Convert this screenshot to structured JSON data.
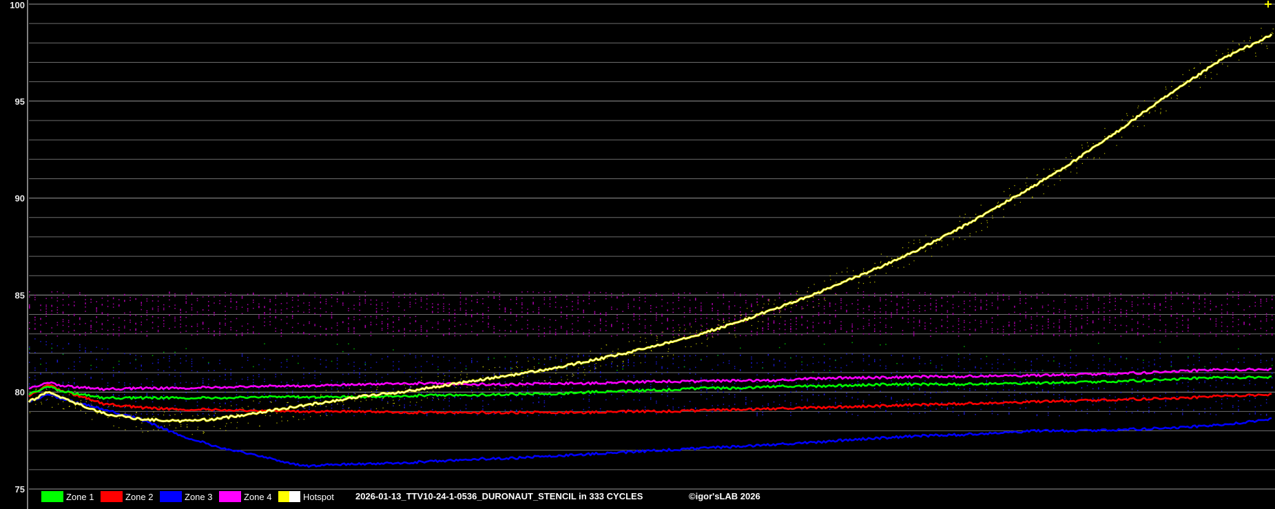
{
  "chart_data": {
    "type": "line",
    "title": "",
    "caption": "2026-01-13_TTV10-24-1-0536_DURONAUT_STENCIL in 333 CYCLES",
    "copyright": "©igor'sLAB 2026",
    "xlabel": "",
    "ylabel": "",
    "ylim": [
      75,
      100
    ],
    "xlim": [
      0,
      333
    ],
    "y_ticks": [
      "100",
      "95",
      "90",
      "85",
      "80",
      "75"
    ],
    "y_tick_values": [
      100,
      95,
      90,
      85,
      80,
      75
    ],
    "grid": true,
    "legend_position": "bottom-left",
    "background": "#000000",
    "series": [
      {
        "name": "Zone 1",
        "color": "#00ff00",
        "x": [
          0,
          5,
          10,
          20,
          30,
          40,
          50,
          60,
          70,
          80,
          90,
          100,
          110,
          120,
          130,
          140,
          150,
          160,
          170,
          180,
          190,
          200,
          210,
          220,
          230,
          240,
          250,
          260,
          270,
          280,
          290,
          300,
          310,
          320,
          333
        ],
        "y": [
          79.9,
          80.3,
          80.0,
          79.7,
          79.7,
          79.7,
          79.7,
          79.75,
          79.75,
          79.75,
          79.75,
          79.8,
          79.85,
          79.85,
          79.9,
          79.9,
          80.0,
          80.05,
          80.1,
          80.2,
          80.2,
          80.3,
          80.3,
          80.35,
          80.4,
          80.4,
          80.4,
          80.45,
          80.45,
          80.5,
          80.55,
          80.6,
          80.7,
          80.75,
          80.75
        ]
      },
      {
        "name": "Zone 2",
        "color": "#ff0000",
        "x": [
          0,
          5,
          10,
          20,
          30,
          40,
          50,
          60,
          70,
          80,
          90,
          100,
          110,
          120,
          130,
          140,
          150,
          160,
          170,
          180,
          190,
          200,
          210,
          220,
          230,
          240,
          250,
          260,
          270,
          280,
          290,
          300,
          310,
          320,
          333
        ],
        "y": [
          79.8,
          80.4,
          80.0,
          79.4,
          79.2,
          79.1,
          79.1,
          79.05,
          79.0,
          79.0,
          79.0,
          78.95,
          78.95,
          78.95,
          78.95,
          78.95,
          78.95,
          79.0,
          79.0,
          79.05,
          79.1,
          79.15,
          79.2,
          79.25,
          79.3,
          79.35,
          79.4,
          79.45,
          79.5,
          79.55,
          79.6,
          79.65,
          79.7,
          79.8,
          79.85
        ]
      },
      {
        "name": "Zone 3",
        "color": "#0000ff",
        "x": [
          0,
          5,
          10,
          20,
          30,
          40,
          50,
          60,
          70,
          75,
          80,
          90,
          100,
          110,
          120,
          130,
          140,
          150,
          160,
          170,
          180,
          190,
          200,
          210,
          220,
          230,
          240,
          250,
          260,
          270,
          280,
          290,
          300,
          310,
          320,
          333
        ],
        "y": [
          79.5,
          79.9,
          79.6,
          79.1,
          78.6,
          77.8,
          77.2,
          76.8,
          76.3,
          76.2,
          76.25,
          76.3,
          76.35,
          76.45,
          76.55,
          76.6,
          76.7,
          76.8,
          76.9,
          77.0,
          77.1,
          77.2,
          77.3,
          77.4,
          77.55,
          77.65,
          77.75,
          77.8,
          77.9,
          78.0,
          78.0,
          78.05,
          78.1,
          78.2,
          78.3,
          78.6
        ]
      },
      {
        "name": "Zone 4",
        "color": "#ff00ff",
        "x": [
          0,
          5,
          10,
          20,
          30,
          40,
          50,
          60,
          70,
          80,
          90,
          100,
          110,
          120,
          130,
          140,
          150,
          160,
          170,
          180,
          190,
          200,
          210,
          220,
          230,
          240,
          250,
          260,
          270,
          280,
          290,
          300,
          310,
          320,
          333
        ],
        "y": [
          80.2,
          80.5,
          80.3,
          80.15,
          80.2,
          80.2,
          80.25,
          80.3,
          80.3,
          80.35,
          80.4,
          80.45,
          80.45,
          80.4,
          80.4,
          80.45,
          80.45,
          80.5,
          80.55,
          80.55,
          80.6,
          80.6,
          80.7,
          80.75,
          80.75,
          80.8,
          80.8,
          80.85,
          80.85,
          80.9,
          80.95,
          81.0,
          81.1,
          81.15,
          81.15
        ]
      },
      {
        "name": "Hotspot",
        "color": "#ffff00",
        "x": [
          0,
          5,
          10,
          20,
          30,
          40,
          50,
          60,
          70,
          80,
          90,
          100,
          110,
          120,
          130,
          140,
          150,
          160,
          170,
          180,
          190,
          200,
          210,
          220,
          230,
          240,
          250,
          260,
          270,
          280,
          290,
          300,
          310,
          320,
          333
        ],
        "y": [
          79.5,
          80.0,
          79.6,
          78.9,
          78.6,
          78.5,
          78.6,
          78.9,
          79.2,
          79.5,
          79.8,
          80.0,
          80.3,
          80.6,
          80.9,
          81.2,
          81.6,
          82.0,
          82.5,
          83.0,
          83.6,
          84.3,
          85.0,
          85.8,
          86.6,
          87.5,
          88.5,
          89.6,
          90.7,
          91.9,
          93.2,
          94.6,
          95.9,
          97.2,
          98.4
        ]
      }
    ]
  },
  "legend": [
    {
      "label": "Zone 1",
      "color": "#00ff00"
    },
    {
      "label": "Zone 2",
      "color": "#ff0000"
    },
    {
      "label": "Zone 3",
      "color": "#0000ff"
    },
    {
      "label": "Zone 4",
      "color": "#ff00ff"
    },
    {
      "label": "Hotspot",
      "color": "#ffff00",
      "color2": "#ffffff"
    }
  ]
}
